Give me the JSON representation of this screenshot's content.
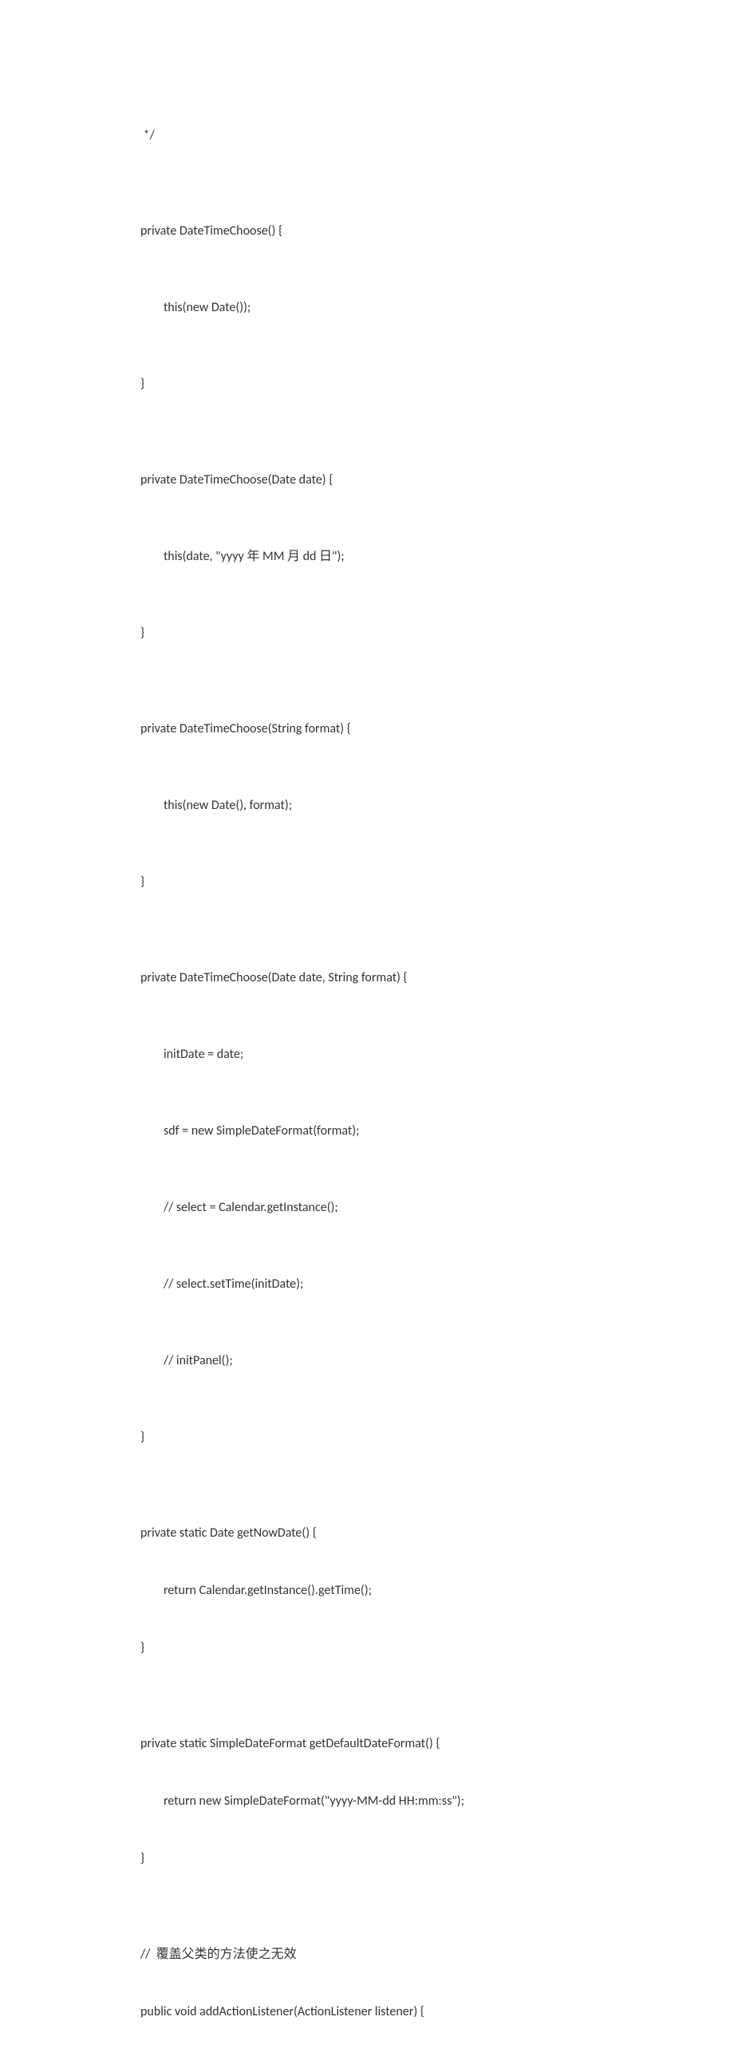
{
  "lines": {
    "l1": " */",
    "l2": "private DateTimeChoose() {",
    "l3": "        this(new Date());",
    "l4": "}",
    "l5": "private DateTimeChoose(Date date) {",
    "l6": "        this(date, \"yyyy 年 MM 月 dd 日\");",
    "l7": "}",
    "l8": "private DateTimeChoose(String format) {",
    "l9": "        this(new Date(), format);",
    "l10": "}",
    "l11": "private DateTimeChoose(Date date, String format) {",
    "l12": "        initDate = date;",
    "l13": "        sdf = new SimpleDateFormat(format);",
    "l14": "        // select = Calendar.getInstance();",
    "l15": "        // select.setTime(initDate);",
    "l16": "        // initPanel();",
    "l17": "}",
    "l18": "private static Date getNowDate() {",
    "l19": "        return Calendar.getInstance().getTime();",
    "l20": "}",
    "l21": "private static SimpleDateFormat getDefaultDateFormat() {",
    "l22": "        return new SimpleDateFormat(\"yyyy-MM-dd HH:mm:ss\");",
    "l23": "}",
    "l24": "//  覆盖父类的方法使之无效",
    "l25": "public void addActionListener(ActionListener listener) {"
  }
}
